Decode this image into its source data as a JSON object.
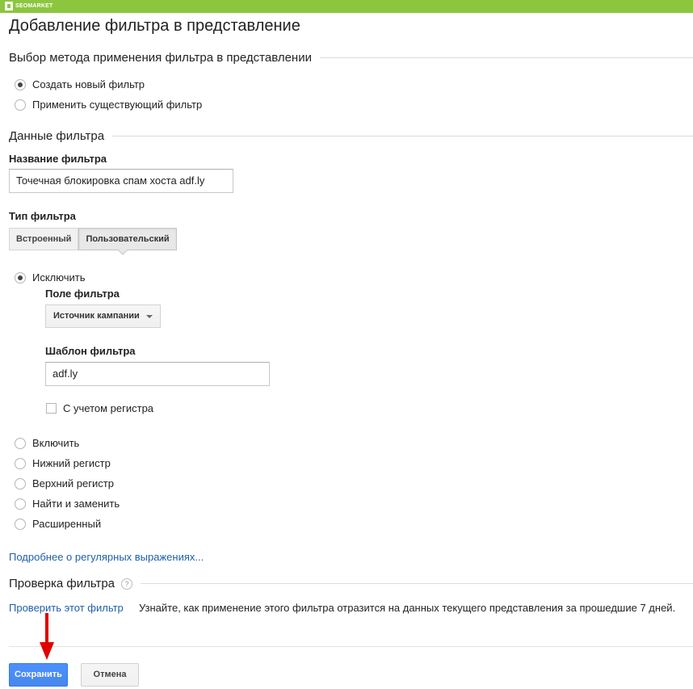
{
  "brand": {
    "name": "SEOMARKET"
  },
  "page": {
    "title": "Добавление фильтра в представление"
  },
  "method": {
    "section_title": "Выбор метода применения фильтра в представлении",
    "options": [
      {
        "label": "Создать новый фильтр",
        "checked": true
      },
      {
        "label": "Применить существующий фильтр",
        "checked": false
      }
    ]
  },
  "filter_data": {
    "section_title": "Данные фильтра",
    "name_label": "Название фильтра",
    "name_value": "Точечная блокировка спам хоста adf.ly",
    "type_label": "Тип фильтра",
    "tabs": [
      {
        "label": "Встроенный",
        "active": false
      },
      {
        "label": "Пользовательский",
        "active": true
      }
    ],
    "exclude": {
      "label": "Исключить",
      "checked": true,
      "field_label": "Поле фильтра",
      "field_value": "Источник кампании",
      "pattern_label": "Шаблон фильтра",
      "pattern_value": "adf.ly",
      "case_label": "С учетом регистра",
      "case_checked": false
    },
    "other_options": [
      {
        "label": "Включить",
        "checked": false
      },
      {
        "label": "Нижний регистр",
        "checked": false
      },
      {
        "label": "Верхний регистр",
        "checked": false
      },
      {
        "label": "Найти и заменить",
        "checked": false
      },
      {
        "label": "Расширенный",
        "checked": false
      }
    ],
    "regex_link": "Подробнее о регулярных выражениях..."
  },
  "verify": {
    "section_title": "Проверка фильтра",
    "help_icon": "?",
    "link": "Проверить этот фильтр",
    "description": "Узнайте, как применение этого фильтра отразится на данных текущего представления за прошедшие 7 дней."
  },
  "actions": {
    "save": "Сохранить",
    "cancel": "Отмена"
  },
  "colors": {
    "topbar": "#8cc63f",
    "primary_button": "#4d90fe",
    "link": "#1f5fa8",
    "annotation_arrow": "#e00000"
  }
}
